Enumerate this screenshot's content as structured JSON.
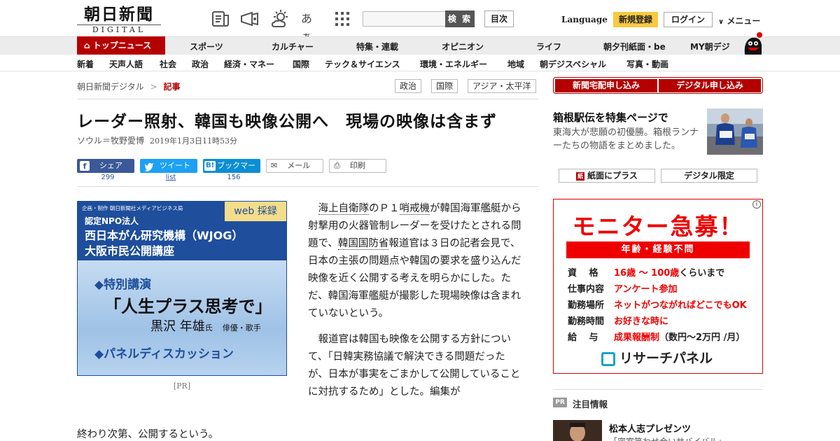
{
  "header": {
    "logo_main": "朝日新聞",
    "logo_sub": "DIGITAL",
    "search_button": "検 索",
    "toc_button": "目次",
    "language": "Language",
    "signup": "新規登録",
    "login": "ログイン",
    "menu": "メニュー",
    "font_icon_text": "あぁ"
  },
  "nav_primary": {
    "top_news": "トップニュース",
    "items": [
      "スポーツ",
      "カルチャー",
      "特集・連載",
      "オピニオン",
      "ライフ",
      "朝夕刊紙面・be",
      "MY朝デジ"
    ]
  },
  "nav_secondary": {
    "items": [
      "新着",
      "天声人語",
      "社会",
      "政治",
      "経済・マネー",
      "国際",
      "テック＆サイエンス",
      "環境・エネルギー",
      "地域",
      "朝デジスペシャル",
      "写真・動画"
    ]
  },
  "breadcrumb": {
    "home": "朝日新聞デジタル",
    "separator": ">",
    "current": "記事"
  },
  "tags": [
    "政治",
    "国際",
    "アジア・太平洋"
  ],
  "article": {
    "title": "レーダー照射、韓国も映像公開へ　現場の映像は含まず",
    "author": "ソウル＝牧野愛博",
    "date": "2019年1月3日11時53分",
    "para1_link1": "海上自衛隊",
    "para1_a": "のＰ１",
    "para1_link2": "哨戒機",
    "para1_b": "が韓国海軍艦艇から射撃用の火器管制レーダーを受けたとされる問題で、",
    "para1_link3": "韓国国防省",
    "para1_c": "報道官は３日の記者会見で、日本の主張の問題点や韓国の要求を盛り込んだ映像を近く公開する考えを明らかにした。ただ、韓国海軍艦艇が撮影した現場映像は含まれていないという。",
    "para2": "報道官は韓国も映像を公開する方針について、「日韓実務協議で解決できる問題だったが、日本が事実をごまかして公開していることに対抗するため」とした。編集が",
    "para2_wrap": "終わり次第、公開するという。"
  },
  "share": {
    "facebook": "シェア",
    "facebook_count": "299",
    "twitter": "ツイート",
    "twitter_count": "list",
    "hatena": "ブックマーク",
    "hatena_badge": "B!",
    "hatena_count": "156",
    "mail": "メール",
    "print": "印刷"
  },
  "ad_left": {
    "credit": "企画・制作 朝日新聞社メディアビジネス局",
    "badge": "web 採録",
    "org_line1": "認定NPO法人",
    "org_line2": "西日本がん研究機構（WJOG）",
    "org_line3": "大阪市民公開講座",
    "section1": "◆特別講演",
    "lecture_title": "「人生プラス思考で」",
    "speaker": "黒沢 年雄",
    "speaker_suffix": "氏",
    "speaker_role": "俳優・歌手",
    "section2": "◆パネルディスカッション",
    "pr_label": "[PR]"
  },
  "right": {
    "btn_home_delivery": "新聞宅配申し込み",
    "btn_digital": "デジタル申し込み",
    "feature_title": "箱根駅伝を特集ページで",
    "feature_desc": "東海大が悲願の初優勝。箱根ランナーたちの物語をまとめました。",
    "btn_paper_plus": "紙面にプラス",
    "btn_digital_only": "デジタル限定",
    "pr_badge": "PR",
    "pr_heading": "注目情報",
    "pr_item_title": "松本人志プレゼンツ",
    "pr_item_desc": "「密室笑わせ合いサバイバル」"
  },
  "ad_right": {
    "headline": "モニター急募！",
    "subline": "年齢・経験不問",
    "rows": [
      {
        "k": "資　 格",
        "v": "16歳 〜 100歳",
        "v2": "くらいまで"
      },
      {
        "k": "仕事内容",
        "v": "アンケート参加",
        "v2": ""
      },
      {
        "k": "勤務場所",
        "v": "ネットがつながればどこでもOK",
        "v2": ""
      },
      {
        "k": "勤務時間",
        "v": "お好きな時に",
        "v2": ""
      },
      {
        "k": "給　 与",
        "v": "成果報酬制",
        "v2": "（数円〜2万円 /月）"
      }
    ],
    "brand": "リサーチパネル"
  },
  "colors": {
    "brand_red": "#b50000",
    "signup_yellow": "#f8c93f",
    "ad_blue": "#1e4e9c",
    "ad_red": "#e00000"
  }
}
